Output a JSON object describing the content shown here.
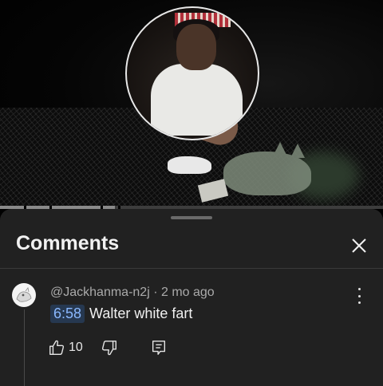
{
  "video": {
    "progress_fraction": 0.3
  },
  "comments": {
    "title": "Comments",
    "items": [
      {
        "author": "@Jackhanma-n2j",
        "separator": "·",
        "age": "2 mo ago",
        "timestamp_link": "6:58",
        "text": "Walter white fart",
        "like_count": "10"
      }
    ]
  },
  "icons": {
    "close": "close-icon",
    "like": "thumb-up-icon",
    "dislike": "thumb-down-icon",
    "reply": "reply-icon",
    "more": "more-vertical-icon"
  },
  "colors": {
    "sheet_background": "#212121",
    "timestamp_background": "#263850",
    "timestamp_text": "#8ab8ff",
    "meta_text": "#aaaaaa"
  }
}
